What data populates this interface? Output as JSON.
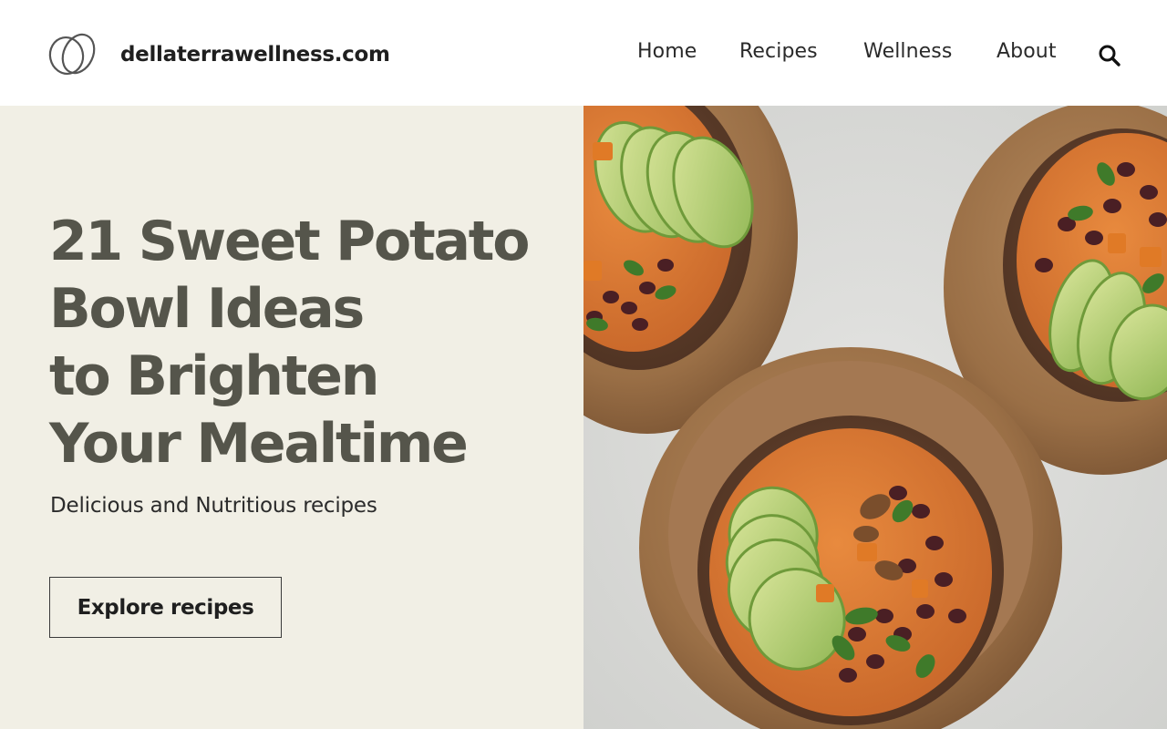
{
  "header": {
    "site_name": "dellaterrawellness.com",
    "logo_icon": "interlocking-rings-logo",
    "nav": [
      {
        "label": "Home"
      },
      {
        "label": "Recipes"
      },
      {
        "label": "Wellness"
      },
      {
        "label": "About"
      }
    ],
    "search_icon": "search-icon"
  },
  "hero": {
    "title_lines": [
      "21 Sweet Potato",
      "Bowl Ideas",
      "to Brighten",
      "Your Mealtime"
    ],
    "subtitle": "Delicious and Nutritious recipes",
    "cta_label": "Explore recipes",
    "background_color": "#f1efe5",
    "title_color": "#55554b",
    "image_subject": "sweet-potato-bowls-photo"
  }
}
